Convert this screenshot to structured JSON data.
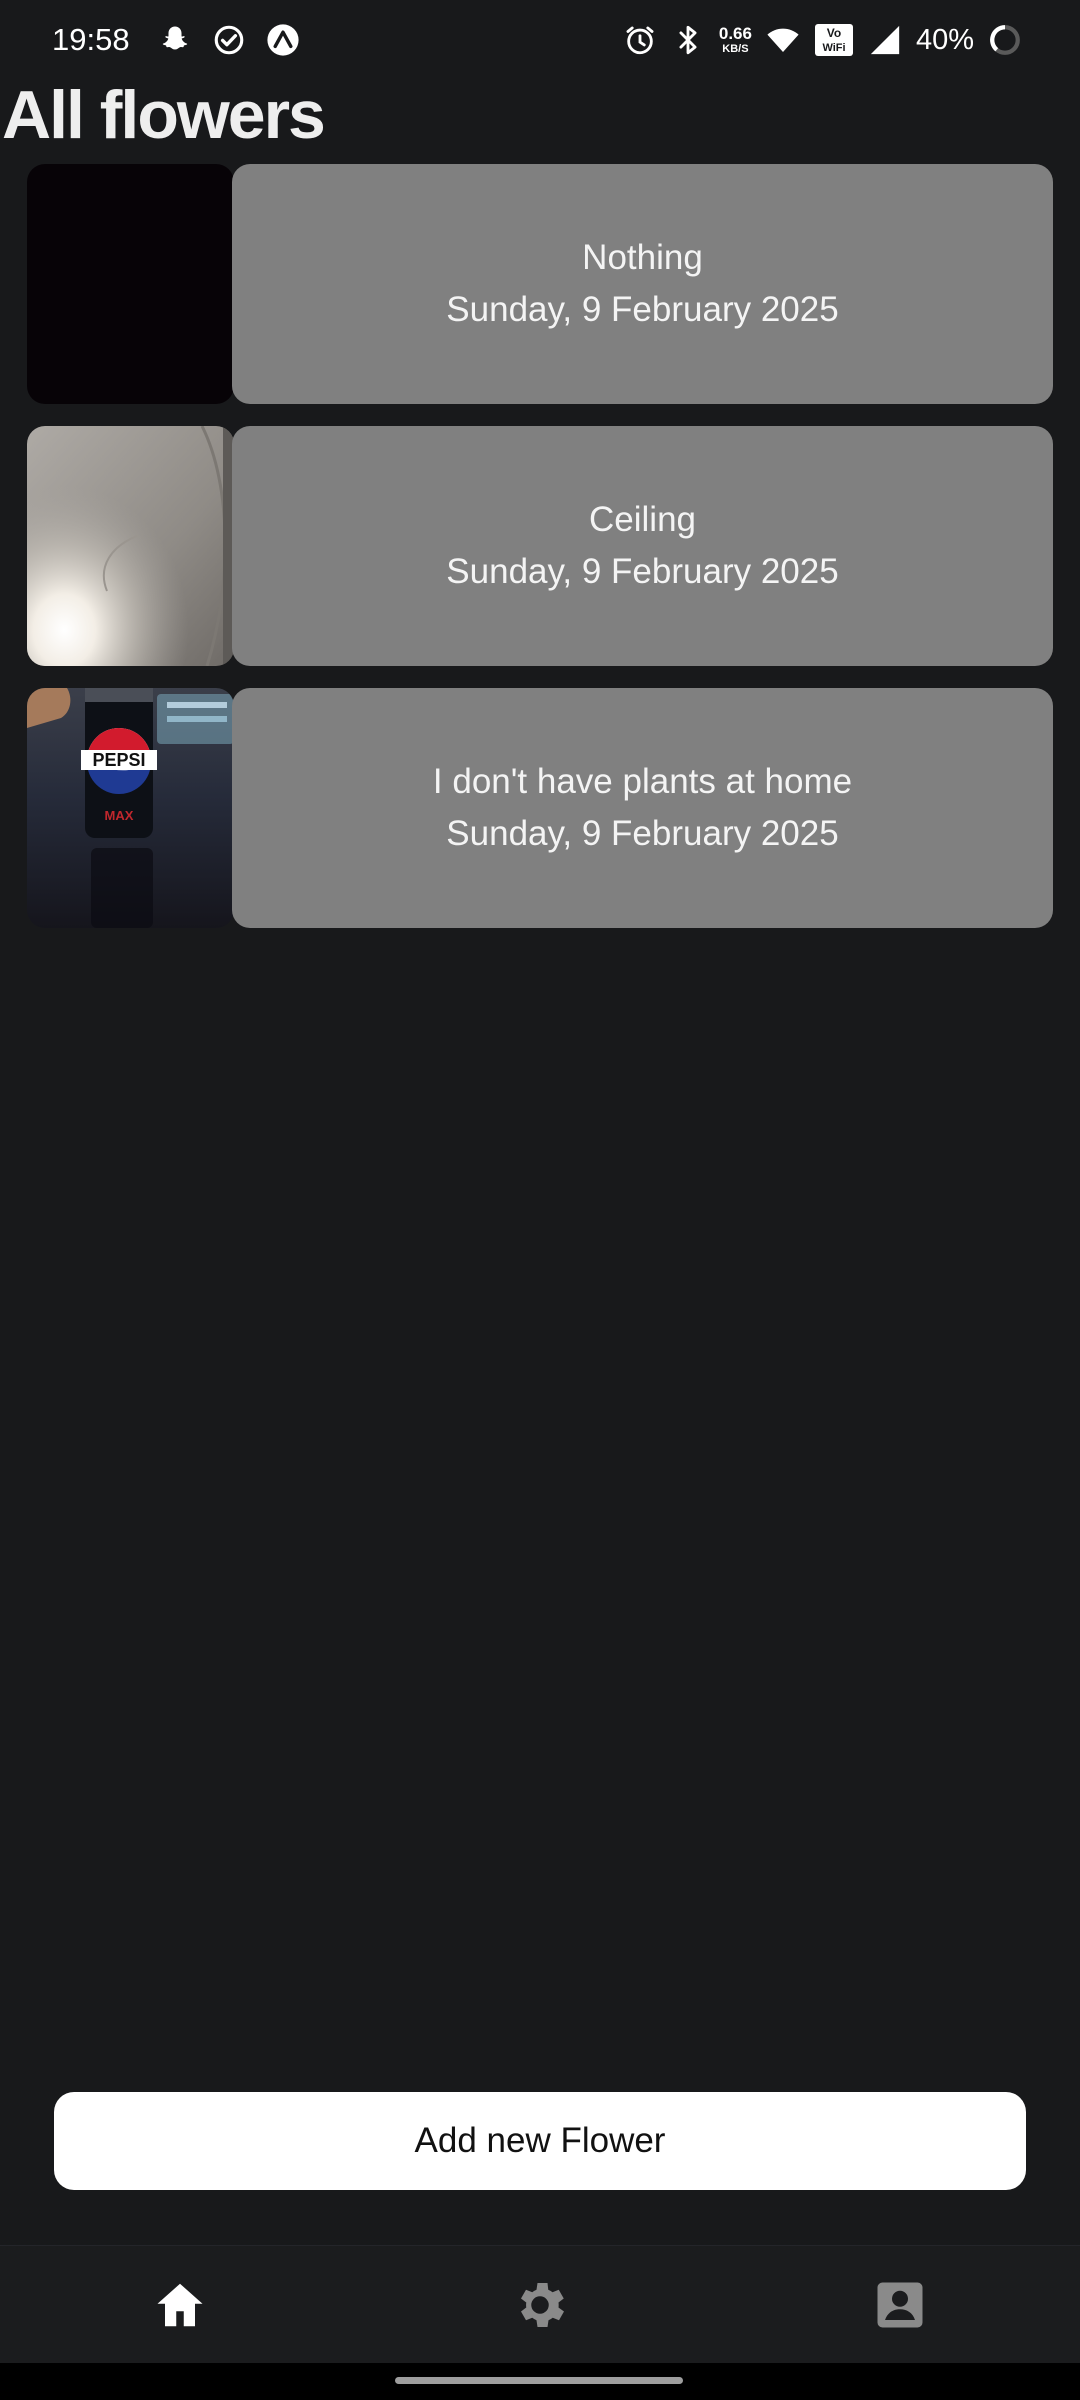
{
  "status_bar": {
    "time": "19:58",
    "network_speed_value": "0.66",
    "network_speed_unit": "KB/S",
    "vowifi_label_top": "Vo",
    "vowifi_label_bottom": "WiFi",
    "battery_percent": "40%",
    "left_icons": [
      "snapchat-icon",
      "check-circle-icon",
      "expo-icon"
    ],
    "right_icons": [
      "alarm-icon",
      "bluetooth-icon",
      "wifi-icon",
      "vowifi-icon",
      "cell-signal-icon",
      "battery-ring-icon"
    ]
  },
  "page": {
    "title": "All flowers"
  },
  "flowers": [
    {
      "name": "Nothing",
      "date": "Sunday, 9 February 2025",
      "thumbnail": "dark-photo"
    },
    {
      "name": "Ceiling",
      "date": "Sunday, 9 February 2025",
      "thumbnail": "ceiling-light-photo"
    },
    {
      "name": "I don't have plants at home",
      "date": "Sunday, 9 February 2025",
      "thumbnail": "soda-can-photo",
      "thumbnail_text": "PEPSI",
      "thumbnail_subtext": "MAX"
    }
  ],
  "actions": {
    "add_button_label": "Add new Flower"
  },
  "bottom_nav": {
    "items": [
      {
        "icon": "home-icon",
        "active": true
      },
      {
        "icon": "gear-icon",
        "active": false
      },
      {
        "icon": "account-box-icon",
        "active": false
      }
    ]
  },
  "colors": {
    "background": "#18191b",
    "card": "#808080",
    "button": "#ffffff",
    "nav_active": "#ffffff",
    "nav_inactive": "#8a8a8a"
  }
}
